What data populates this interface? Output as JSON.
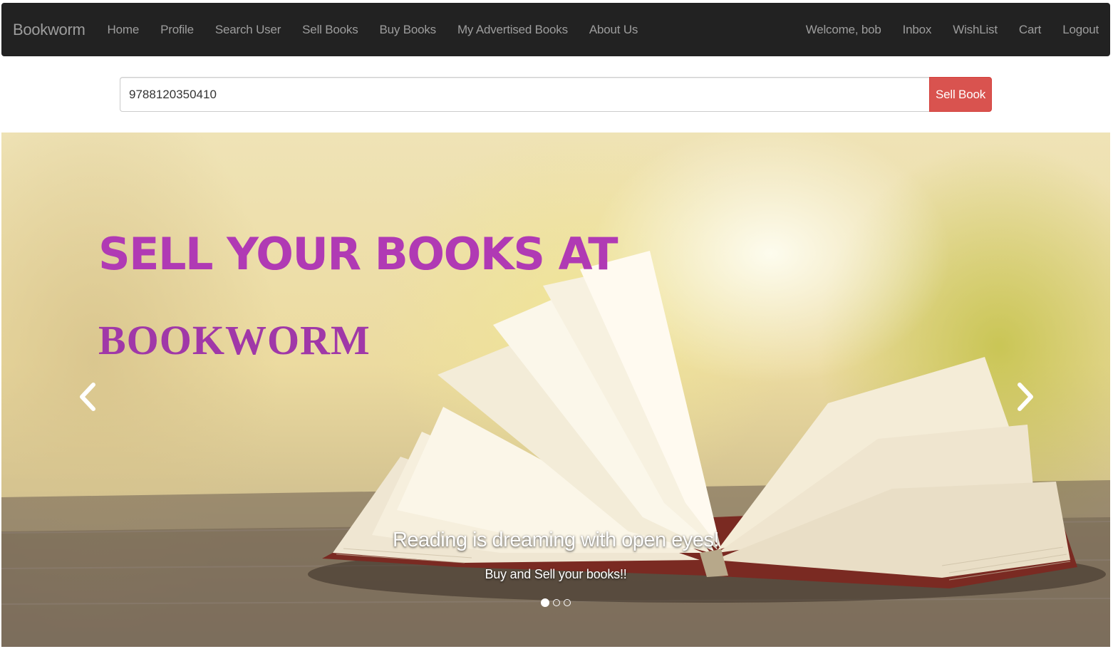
{
  "navbar": {
    "brand": "Bookworm",
    "left_items": [
      "Home",
      "Profile",
      "Search User",
      "Sell Books",
      "Buy Books",
      "My Advertised Books",
      "About Us"
    ],
    "right_items": [
      "Welcome, bob",
      "Inbox",
      "WishList",
      "Cart",
      "Logout"
    ]
  },
  "search": {
    "value": "9788120350410",
    "button_label": "Sell Book"
  },
  "carousel": {
    "headline": "SELL YOUR BOOKS AT",
    "brand_word": "BOOKWORM",
    "caption_title": "Reading is dreaming with open eyes!",
    "caption_subtitle": "Buy and Sell your books!!",
    "slide_count": 3,
    "active_slide": 1
  },
  "colors": {
    "navbar_bg": "#222222",
    "nav_text": "#9d9d9d",
    "button_danger": "#d9534f",
    "headline": "#b03ab4"
  }
}
